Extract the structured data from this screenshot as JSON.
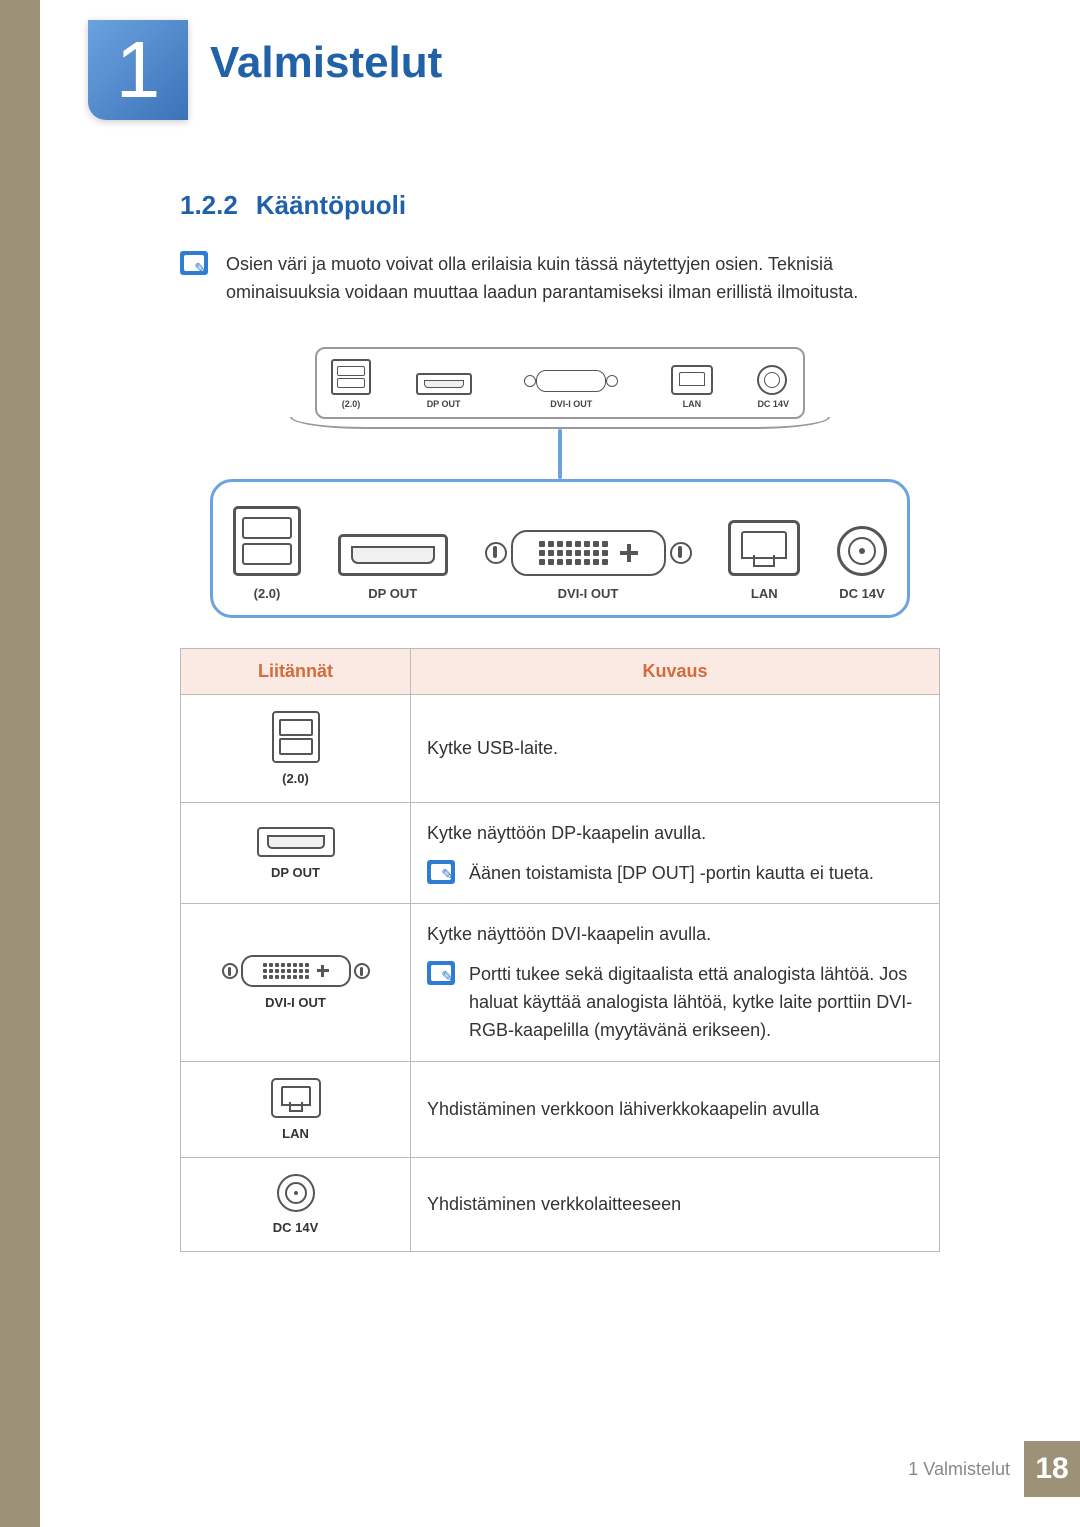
{
  "chapter": {
    "number": "1",
    "title": "Valmistelut"
  },
  "section": {
    "number": "1.2.2",
    "title": "Kääntöpuoli"
  },
  "intro_note": "Osien väri ja muoto voivat olla erilaisia kuin tässä näytettyjen osien. Teknisiä ominaisuuksia voidaan muuttaa laadun parantamiseksi ilman erillistä ilmoitusta.",
  "port_labels": {
    "usb": "(2.0)",
    "dp": "DP OUT",
    "dvi": "DVI-I OUT",
    "lan": "LAN",
    "dc": "DC 14V"
  },
  "table": {
    "headers": {
      "col1": "Liitännät",
      "col2": "Kuvaus"
    },
    "rows": [
      {
        "icon": "usb",
        "label": "(2.0)",
        "desc": "Kytke USB-laite."
      },
      {
        "icon": "dp",
        "label": "DP OUT",
        "desc": "Kytke näyttöön DP-kaapelin avulla.",
        "note": "Äänen toistamista [DP OUT] -portin kautta ei tueta."
      },
      {
        "icon": "dvi",
        "label": "DVI-I OUT",
        "desc": "Kytke näyttöön DVI-kaapelin avulla.",
        "note": "Portti tukee sekä digitaalista että analogista lähtöä. Jos haluat käyttää analogista lähtöä, kytke laite porttiin DVI-RGB-kaapelilla (myytävänä erikseen)."
      },
      {
        "icon": "lan",
        "label": "LAN",
        "desc": "Yhdistäminen verkkoon lähiverkkokaapelin avulla"
      },
      {
        "icon": "dc",
        "label": "DC 14V",
        "desc": "Yhdistäminen verkkolaitteeseen"
      }
    ]
  },
  "footer": {
    "chapter_ref": "1 Valmistelut",
    "page": "18"
  }
}
